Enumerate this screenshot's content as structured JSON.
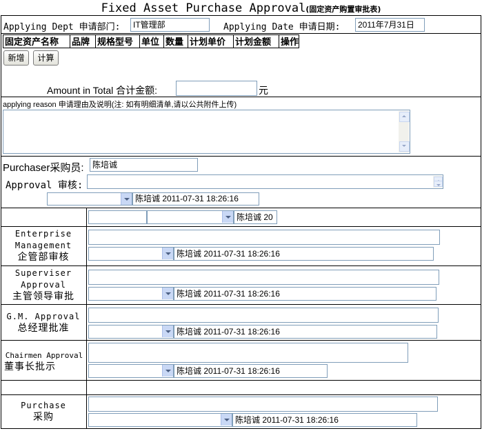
{
  "title": {
    "main": "Fixed Asset Purchase Approval",
    "cn": "(固定资产购置审批表)"
  },
  "header": {
    "dept_label": "Applying Dept 申请部门:",
    "dept_value": "IT管理部",
    "date_label": "Applying Date 申请日期:",
    "date_value": "2011年7月31日"
  },
  "table": {
    "columns": [
      "固定资产名称",
      "品牌",
      "规格型号",
      "单位",
      "数量",
      "计划单价",
      "计划金额",
      "操作"
    ],
    "add_button": "新增",
    "calc_button": "计算"
  },
  "amount": {
    "label": "Amount in Total 合计金额:",
    "value": "",
    "unit": "元"
  },
  "reason": {
    "label": "applying reason 申请理由及说明(注: 如有明细清单,请以公共附件上传)",
    "value": ""
  },
  "purchaser": {
    "label": "Purchaser采购员:",
    "value": "陈培诚"
  },
  "approval": {
    "label": "Approval 审核:",
    "select": "",
    "stamp": "陈培诚  2011-07-31 18:26:16"
  },
  "row_blank": {
    "select": "",
    "stamp": "陈培诚  20"
  },
  "enterprise": {
    "label1": "Enterprise",
    "label2": "Management",
    "label3": "企管部审核",
    "select": "",
    "stamp": "陈培诚  2011-07-31 18:26:16"
  },
  "supervisor": {
    "label1": "Superviser",
    "label2": "Approval",
    "label3": "主管领导审批",
    "select": "",
    "stamp": "陈培诚  2011-07-31 18:26:16"
  },
  "gm": {
    "label1": "G.M. Approval",
    "label2": "总经理批准",
    "select": "",
    "stamp": "陈培诚  2011-07-31 18:26:16"
  },
  "chairman": {
    "label1": "Chairmen Approval",
    "label2": "董事长批示",
    "select": "",
    "stamp": "陈培诚  2011-07-31 18:26:16"
  },
  "purchase": {
    "label1": "Purchase",
    "label2": "采购",
    "select": "",
    "stamp": "陈培诚  2011-07-31 18:26:16"
  }
}
